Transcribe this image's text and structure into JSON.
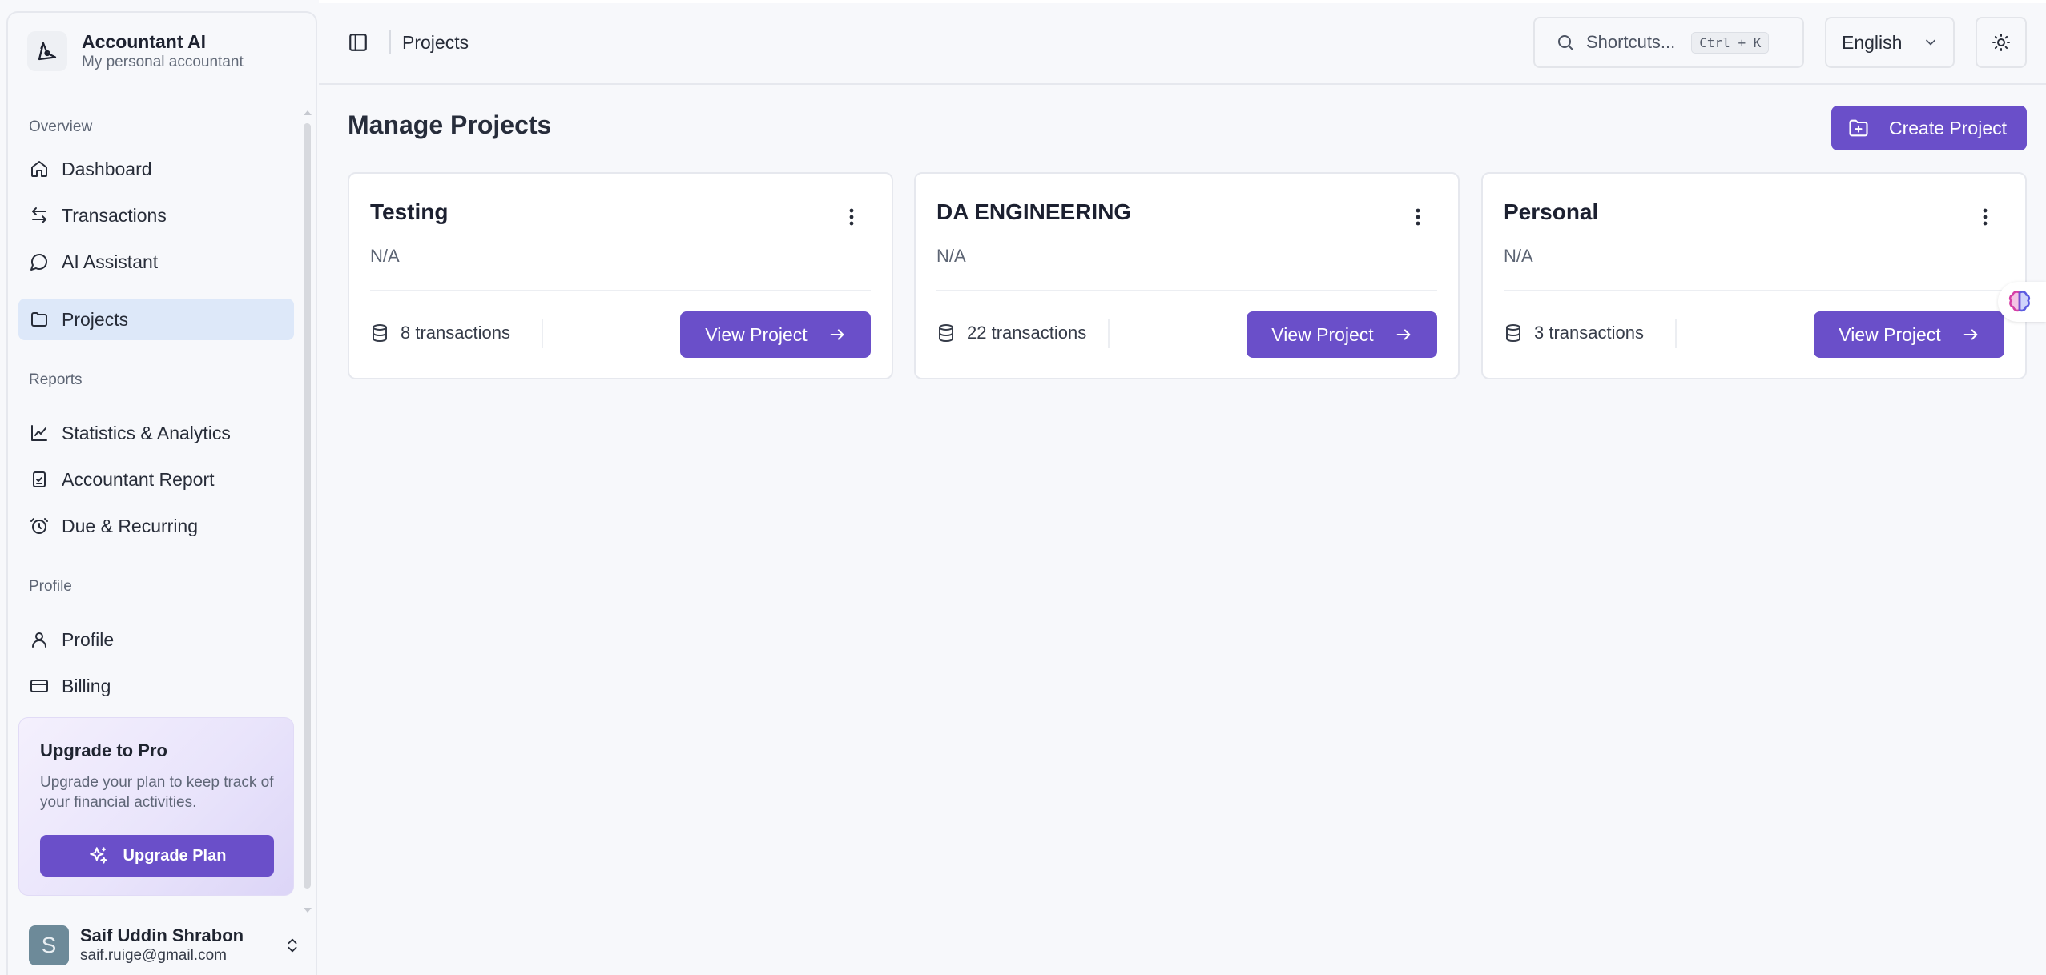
{
  "app": {
    "name": "Accountant AI",
    "tagline": "My personal accountant"
  },
  "sidebar": {
    "sections": {
      "overview": "Overview",
      "reports": "Reports",
      "profile": "Profile"
    },
    "items": [
      {
        "label": "Dashboard",
        "icon": "home-icon"
      },
      {
        "label": "Transactions",
        "icon": "arrows-left-right-icon"
      },
      {
        "label": "AI Assistant",
        "icon": "message-circle-icon"
      },
      {
        "label": "Projects",
        "icon": "folder-icon",
        "active": true
      },
      {
        "label": "Statistics & Analytics",
        "icon": "line-chart-icon"
      },
      {
        "label": "Accountant Report",
        "icon": "clipboard-check-icon"
      },
      {
        "label": "Due & Recurring",
        "icon": "alarm-clock-icon"
      },
      {
        "label": "Profile",
        "icon": "user-icon"
      },
      {
        "label": "Billing",
        "icon": "credit-card-icon"
      }
    ],
    "upgrade": {
      "title": "Upgrade to Pro",
      "description": "Upgrade your plan to keep track of your financial activities.",
      "button": "Upgrade Plan"
    },
    "user": {
      "initial": "S",
      "name": "Saif Uddin Shrabon",
      "email": "saif.ruige@gmail.com"
    }
  },
  "header": {
    "breadcrumb": "Projects",
    "search": {
      "label": "Shortcuts...",
      "shortcut": "Ctrl + K"
    },
    "language": "English"
  },
  "main": {
    "title": "Manage Projects",
    "create_button": "Create Project",
    "projects": [
      {
        "name": "Testing",
        "description": "N/A",
        "transactions": "8 transactions",
        "button": "View Project"
      },
      {
        "name": "DA ENGINEERING",
        "description": "N/A",
        "transactions": "22 transactions",
        "button": "View Project"
      },
      {
        "name": "Personal",
        "description": "N/A",
        "transactions": "3 transactions",
        "button": "View Project"
      }
    ]
  },
  "colors": {
    "accent": "#6a4fc9",
    "active_nav": "#dde8f9",
    "background": "#f7f8fb"
  }
}
